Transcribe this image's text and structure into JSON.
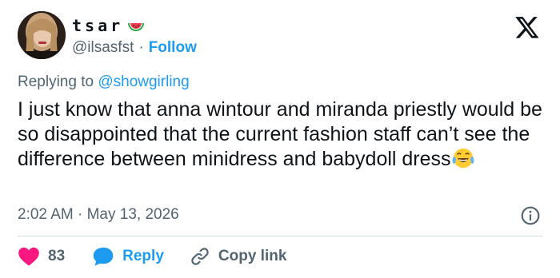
{
  "user": {
    "display_name": "tsar",
    "name_emoji": "watermelon-icon",
    "handle": "@ilsasfst",
    "separator": "·",
    "follow_label": "Follow"
  },
  "replying": {
    "prefix": "Replying to",
    "mention": "@showgirling"
  },
  "tweet": {
    "text": "I just know that anna wintour and miranda priestly would be so disappointed that the current fashion staff can’t see the difference between minidress and babydoll dress",
    "trailing_emoji": "face-with-tears-of-joy-icon"
  },
  "meta": {
    "time": "2:02 AM",
    "separator": "·",
    "date": "May 13, 2026"
  },
  "actions": {
    "like_count": "83",
    "reply_label": "Reply",
    "copy_label": "Copy link"
  },
  "colors": {
    "accent": "#1d9bf0",
    "like": "#f91880",
    "muted": "#536471",
    "text": "#0f1419",
    "divider": "#cfd9de"
  }
}
